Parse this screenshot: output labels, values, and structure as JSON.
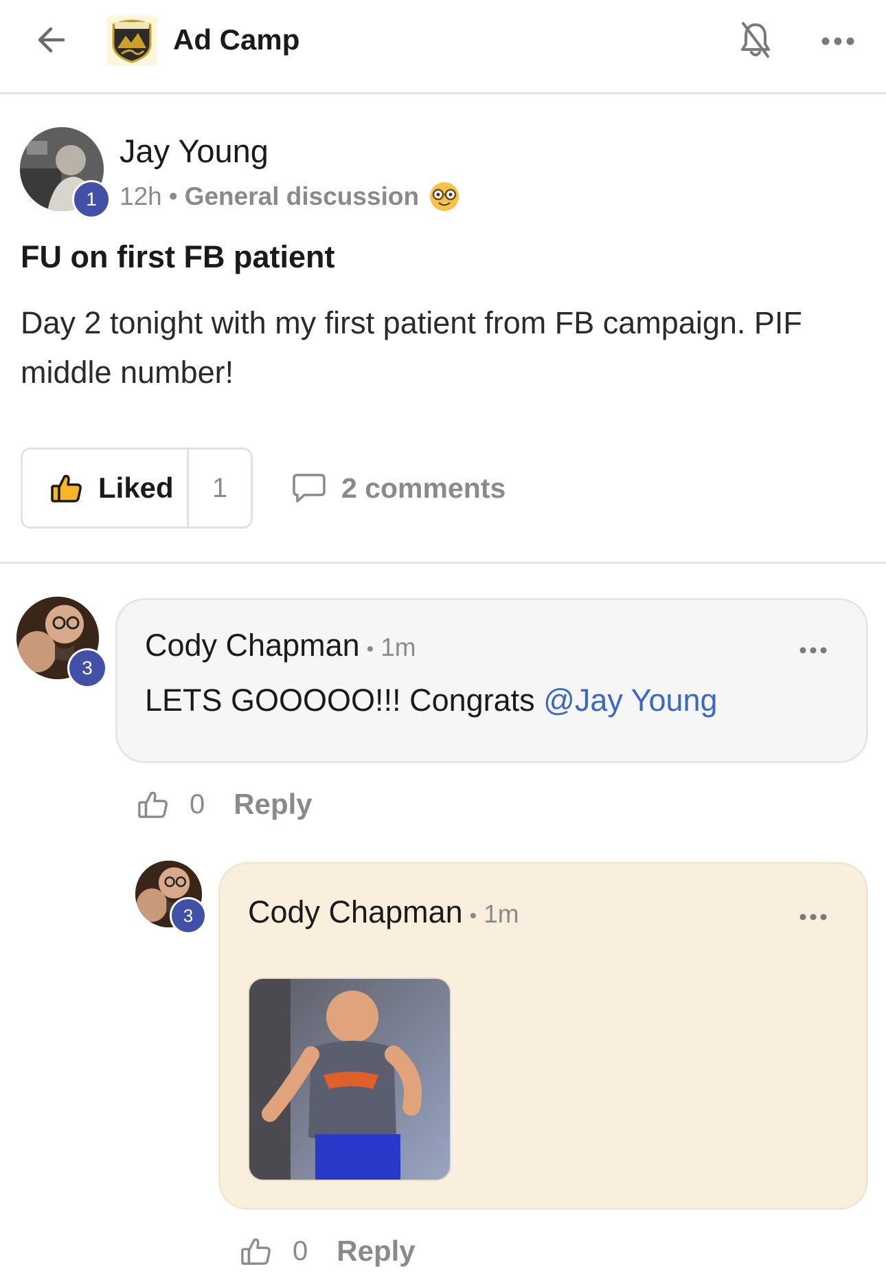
{
  "header": {
    "title": "Ad Camp",
    "logo_text": "AD CAMP"
  },
  "post": {
    "author": "Jay Young",
    "level": "1",
    "time": "12h",
    "separator": "•",
    "category": "General discussion",
    "category_emoji": "nerd-face",
    "title": "FU on first FB patient",
    "body": "Day 2 tonight with my first patient from FB campaign. PIF middle number!",
    "like_label": "Liked",
    "like_count": "1",
    "comments_label": "2 comments"
  },
  "comments": [
    {
      "author": "Cody Chapman",
      "level": "3",
      "separator": "•",
      "time": "1m",
      "text": "LETS GOOOOO!!! Congrats ",
      "mention": "@Jay Young",
      "like_count": "0",
      "reply_label": "Reply"
    },
    {
      "author": "Cody Chapman",
      "level": "3",
      "separator": "•",
      "time": "1m",
      "attachment": "gif",
      "like_count": "0",
      "reply_label": "Reply"
    }
  ],
  "colors": {
    "accent_badge": "#4350a8",
    "mention": "#3b68c4",
    "reply_bubble": "#faefdc",
    "comment_bubble": "#f6f6f6"
  }
}
